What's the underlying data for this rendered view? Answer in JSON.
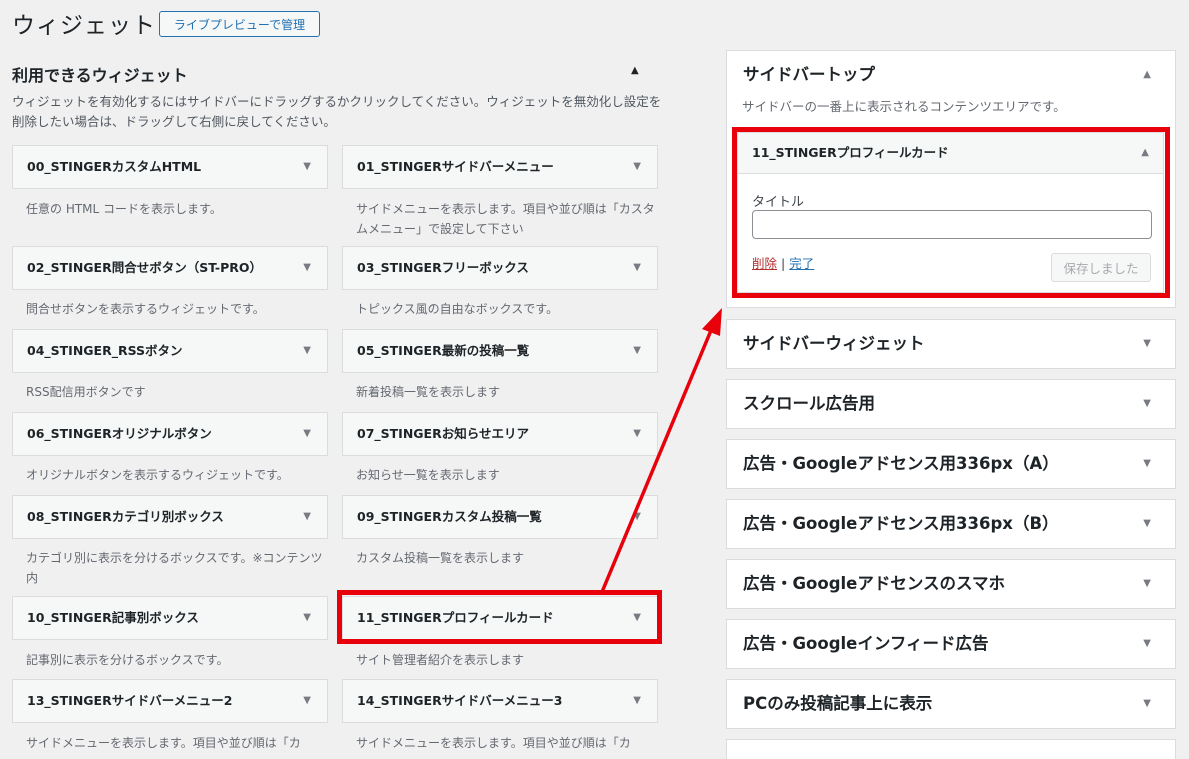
{
  "header": {
    "title": "ウィジェット",
    "preview_button": "ライブプレビューで管理"
  },
  "available": {
    "title": "利用できるウィジェット",
    "description": "ウィジェットを有効化するにはサイドバーにドラッグするかクリックしてください。ウィジェットを無効化し設定を削除したい場合は、ドラッグして右側に戻してください。",
    "widgets": [
      {
        "title": "00_STINGERカスタムHTML",
        "desc": "任意の HTML コードを表示します。"
      },
      {
        "title": "01_STINGERサイドバーメニュー",
        "desc": "サイドメニューを表示します。項目や並び順は「カスタムメニュー」で設定して下さい"
      },
      {
        "title": "02_STINGER問合せボタン（ST-PRO）",
        "desc": "問合せボタンを表示するウィジェットです。"
      },
      {
        "title": "03_STINGERフリーボックス",
        "desc": "トピックス風の自由なボックスです。"
      },
      {
        "title": "04_STINGER_RSSボタン",
        "desc": "RSS配信用ボタンです"
      },
      {
        "title": "05_STINGER最新の投稿一覧",
        "desc": "新着投稿一覧を表示します"
      },
      {
        "title": "06_STINGERオリジナルボタン",
        "desc": "オリジナルボタンを表示するウィジェットです。"
      },
      {
        "title": "07_STINGERお知らせエリア",
        "desc": "お知らせ一覧を表示します"
      },
      {
        "title": "08_STINGERカテゴリ別ボックス",
        "desc": "カテゴリ別に表示を分けるボックスです。※コンテンツ内"
      },
      {
        "title": "09_STINGERカスタム投稿一覧",
        "desc": "カスタム投稿一覧を表示します"
      },
      {
        "title": "10_STINGER記事別ボックス",
        "desc": "記事別に表示を分けるボックスです。"
      },
      {
        "title": "11_STINGERプロフィールカード",
        "desc": "サイト管理者紹介を表示します"
      },
      {
        "title": "13_STINGERサイドバーメニュー2",
        "desc": "サイドメニューを表示します。項目や並び順は「カ"
      },
      {
        "title": "14_STINGERサイドバーメニュー3",
        "desc": "サイドメニューを表示します。項目や並び順は「カ"
      }
    ]
  },
  "sidebar_top": {
    "title": "サイドバートップ",
    "description": "サイドバーの一番上に表示されるコンテンツエリアです。",
    "widget": {
      "title": "11_STINGERプロフィールカード",
      "field_label": "タイトル",
      "field_value": "",
      "delete_link": "削除",
      "separator": "|",
      "done_link": "完了",
      "save_button": "保存しました"
    }
  },
  "sidebars": [
    "サイドバーウィジェット",
    "スクロール広告用",
    "広告・Googleアドセンス用336px（A）",
    "広告・Googleアドセンス用336px（B）",
    "広告・Googleアドセンスのスマホ",
    "広告・Googleインフィード広告",
    "PCのみ投稿記事上に表示"
  ],
  "icons": {
    "toggle_up": "triangle-up-icon",
    "toggle_down": "triangle-down-icon"
  },
  "colors": {
    "highlight": "#e8000b",
    "link": "#2271b1",
    "delete": "#b32d2e"
  }
}
